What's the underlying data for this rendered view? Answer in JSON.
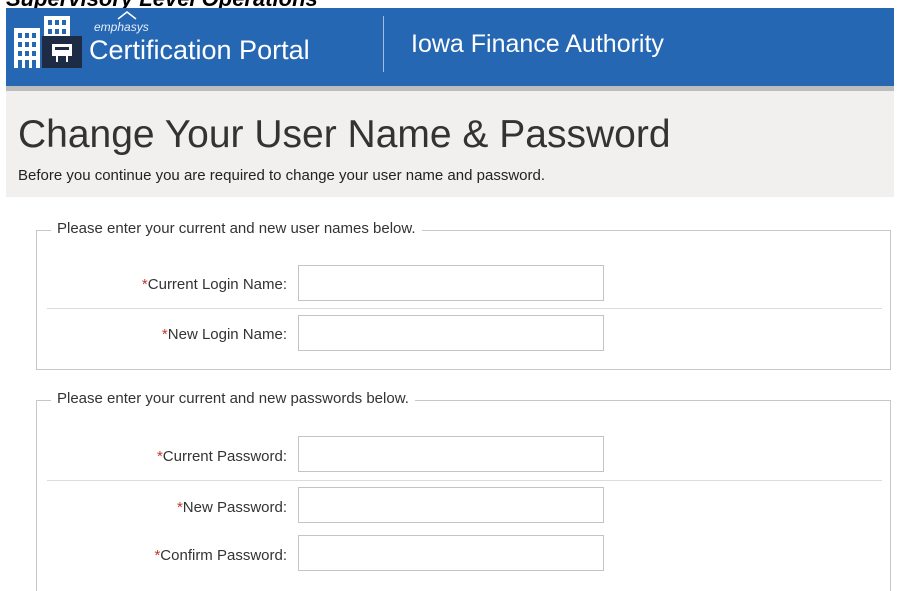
{
  "clipped_top_text": "Supervisory Level Operations",
  "header": {
    "brand_small": "emphasys",
    "brand_title": "Certification Portal",
    "org_name": "Iowa Finance Authority",
    "color": "#2567b3"
  },
  "page": {
    "title": "Change Your User Name & Password",
    "subtitle": "Before you continue you are required to change your user name and password."
  },
  "username_section": {
    "legend": "Please enter your current and new user names below.",
    "fields": [
      {
        "required_mark": "*",
        "label": "Current Login Name:",
        "value": ""
      },
      {
        "required_mark": "*",
        "label": "New Login Name:",
        "value": ""
      }
    ]
  },
  "password_section": {
    "legend": "Please enter your current and new passwords below.",
    "fields": [
      {
        "required_mark": "*",
        "label": "Current Password:",
        "value": ""
      },
      {
        "required_mark": "*",
        "label": "New Password:",
        "value": ""
      },
      {
        "required_mark": "*",
        "label": "Confirm Password:",
        "value": ""
      }
    ]
  }
}
